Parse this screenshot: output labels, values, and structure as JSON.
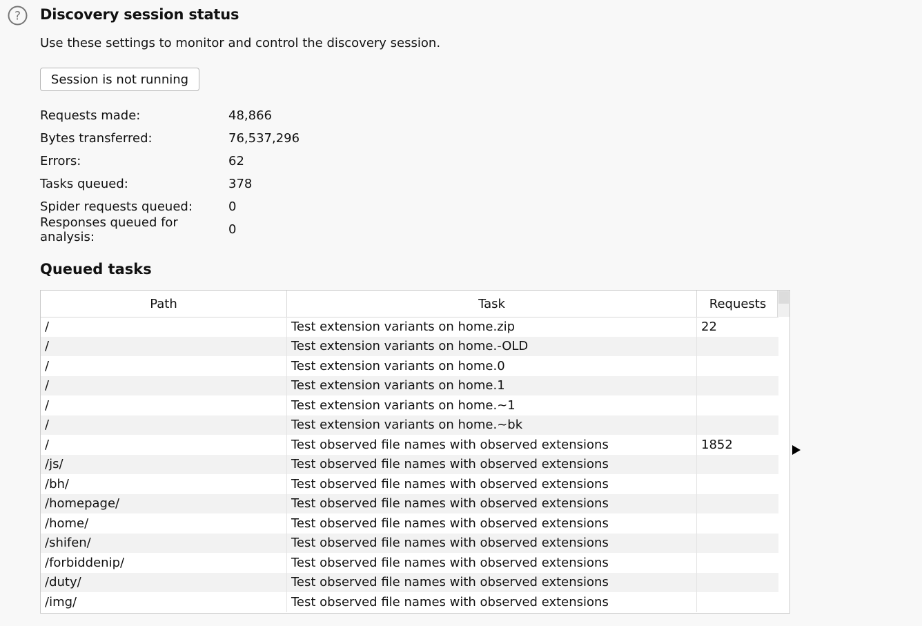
{
  "header": {
    "help_icon": "question-mark-circle-icon",
    "title": "Discovery session status",
    "description": "Use these settings to monitor and control the discovery session."
  },
  "session_button": {
    "label": "Session is not running"
  },
  "stats": [
    {
      "label": "Requests made:",
      "value": "48,866"
    },
    {
      "label": "Bytes transferred:",
      "value": "76,537,296"
    },
    {
      "label": "Errors:",
      "value": "62"
    },
    {
      "label": "Tasks queued:",
      "value": "378"
    },
    {
      "label": "Spider requests queued:",
      "value": "0"
    },
    {
      "label": "Responses queued for analysis:",
      "value": "0"
    }
  ],
  "queued_tasks": {
    "title": "Queued tasks",
    "columns": [
      "Path",
      "Task",
      "Requests"
    ],
    "rows": [
      {
        "path": "/",
        "task": "Test extension variants on home.zip",
        "requests": "22"
      },
      {
        "path": "/",
        "task": "Test extension variants on home.-OLD",
        "requests": ""
      },
      {
        "path": "/",
        "task": "Test extension variants on home.0",
        "requests": ""
      },
      {
        "path": "/",
        "task": "Test extension variants on home.1",
        "requests": ""
      },
      {
        "path": "/",
        "task": "Test extension variants on home.~1",
        "requests": ""
      },
      {
        "path": "/",
        "task": "Test extension variants on home.~bk",
        "requests": ""
      },
      {
        "path": "/",
        "task": "Test observed file names with observed extensions",
        "requests": "1852"
      },
      {
        "path": "/js/",
        "task": "Test observed file names with observed extensions",
        "requests": ""
      },
      {
        "path": "/bh/",
        "task": "Test observed file names with observed extensions",
        "requests": ""
      },
      {
        "path": "/homepage/",
        "task": "Test observed file names with observed extensions",
        "requests": ""
      },
      {
        "path": "/home/",
        "task": "Test observed file names with observed extensions",
        "requests": ""
      },
      {
        "path": "/shifen/",
        "task": "Test observed file names with observed extensions",
        "requests": ""
      },
      {
        "path": "/forbiddenip/",
        "task": "Test observed file names with observed extensions",
        "requests": ""
      },
      {
        "path": "/duty/",
        "task": "Test observed file names with observed extensions",
        "requests": ""
      },
      {
        "path": "/img/",
        "task": "Test observed file names with observed extensions",
        "requests": ""
      }
    ]
  },
  "expand_icon": "triangle-right-icon"
}
